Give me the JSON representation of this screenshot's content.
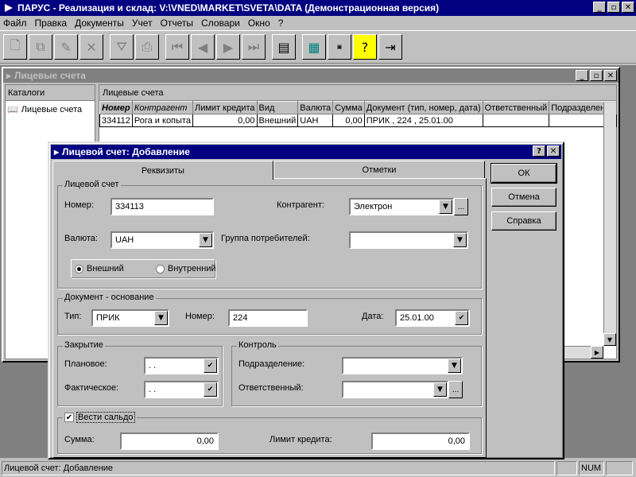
{
  "window": {
    "title": "ПАРУС - Реализация и склад: V:\\VNED\\MARKET\\SVETA\\DATA (Демонстрационная версия)",
    "min": "_",
    "max": "▫",
    "close": "✕"
  },
  "menu": [
    "Файл",
    "Правка",
    "Документы",
    "Учет",
    "Отчеты",
    "Словари",
    "Окно",
    "?"
  ],
  "child": {
    "title": "Лицевые счета",
    "catalogs_header": "Каталоги",
    "tree_item": "Лицевые счета",
    "grid_header": "Лицевые счета",
    "columns": [
      "Номер",
      "Контрагент",
      "Лимит кредита",
      "Вид",
      "Валюта",
      "Сумма",
      "Документ (тип, номер, дата)",
      "Ответственный",
      "Подразделение"
    ],
    "rows": [
      [
        "334112",
        "Рога и копыта",
        "0,00",
        "Внешний",
        "UAH",
        "0,00",
        "ПРИК ,  224 ,  25.01.00",
        "",
        ""
      ]
    ]
  },
  "dialog": {
    "title": "Лицевой счет: Добавление",
    "tabs": [
      "Реквизиты",
      "Отметки"
    ],
    "buttons": {
      "ok": "ОК",
      "cancel": "Отмена",
      "help": "Справка"
    },
    "account": {
      "group": "Лицевой счет",
      "number_label": "Номер:",
      "number": "334113",
      "contractor_label": "Контрагент:",
      "contractor": "Электрон",
      "currency_label": "Валюта:",
      "currency": "UAH",
      "consumer_group_label": "Группа потребителей:",
      "consumer_group": "",
      "external": "Внешний",
      "internal": "Внутренний"
    },
    "document": {
      "group": "Документ - основание",
      "type_label": "Тип:",
      "type": "ПРИК",
      "number_label": "Номер:",
      "number": "224",
      "date_label": "Дата:",
      "date": "25.01.00"
    },
    "closing": {
      "group": "Закрытие",
      "planned_label": "Плановое:",
      "planned": " .  .",
      "actual_label": "Фактическое:",
      "actual": " .  ."
    },
    "control": {
      "group": "Контроль",
      "division_label": "Подразделение:",
      "division": "",
      "responsible_label": "Ответственный:",
      "responsible": ""
    },
    "balance": {
      "checkbox_label": "Вести сальдо",
      "sum_label": "Сумма:",
      "sum": "0,00",
      "limit_label": "Лимит кредита:",
      "limit": "0,00"
    }
  },
  "status": {
    "text": "Лицевой счет: Добавление",
    "num": "NUM"
  }
}
